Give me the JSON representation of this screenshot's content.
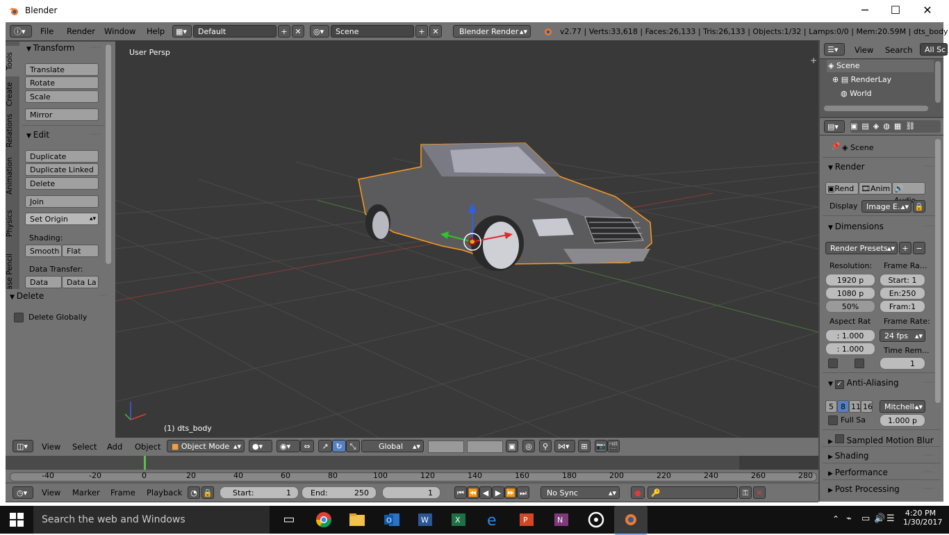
{
  "window": {
    "title": "Blender"
  },
  "info_header": {
    "menus": [
      "File",
      "Render",
      "Window",
      "Help"
    ],
    "layout": "Default",
    "scene": "Scene",
    "engine": "Blender Render",
    "stats": "v2.77 | Verts:33,618 | Faces:26,133 | Tris:26,133 | Objects:1/32 | Lamps:0/0 | Mem:20.59M | dts_body"
  },
  "tool_tabs": [
    "Tools",
    "Create",
    "Relations",
    "Animation",
    "Physics",
    "Grease Pencil"
  ],
  "toolshelf": {
    "transform_title": "Transform",
    "translate": "Translate",
    "rotate": "Rotate",
    "scale": "Scale",
    "mirror": "Mirror",
    "edit_title": "Edit",
    "duplicate": "Duplicate",
    "duplicate_linked": "Duplicate Linked",
    "delete": "Delete",
    "join": "Join",
    "set_origin": "Set Origin",
    "shading_label": "Shading:",
    "smooth": "Smooth",
    "flat": "Flat",
    "data_transfer_label": "Data Transfer:",
    "data": "Data",
    "data_layout": "Data La"
  },
  "operator_panel": {
    "title": "Delete",
    "delete_globally": "Delete Globally"
  },
  "viewport": {
    "view_name": "User Persp",
    "object_name": "(1) dts_body"
  },
  "viewport_header": {
    "menus": [
      "View",
      "Select",
      "Add",
      "Object"
    ],
    "mode": "Object Mode",
    "orientation": "Global"
  },
  "timeline": {
    "ticks": [
      "-40",
      "-20",
      "0",
      "20",
      "40",
      "60",
      "80",
      "100",
      "120",
      "140",
      "160",
      "180",
      "200",
      "220",
      "240",
      "260",
      "280"
    ],
    "current_frame_marker": 0,
    "menus": [
      "View",
      "Marker",
      "Frame",
      "Playback"
    ],
    "start_label": "Start:",
    "start": "1",
    "end_label": "End:",
    "end": "250",
    "current": "1",
    "sync": "No Sync"
  },
  "outliner": {
    "menus": [
      "View",
      "Search"
    ],
    "filter": "All Sc",
    "items": [
      "Scene",
      "RenderLay",
      "World"
    ]
  },
  "properties": {
    "context": "Scene",
    "render_title": "Render",
    "render_btn": "Rend",
    "anim_btn": "Anim",
    "audio_btn": "Audio",
    "display_label": "Display",
    "display_value": "Image E...",
    "dimensions_title": "Dimensions",
    "render_presets": "Render Presets",
    "resolution_label": "Resolution:",
    "res_x": "1920 p",
    "res_y": "1080 p",
    "res_pct": "50%",
    "frame_range_label": "Frame Ra...",
    "frame_start": "Start: 1",
    "frame_end": "En:250",
    "frame_step": "Fram:1",
    "aspect_label": "Aspect Rat",
    "aspect_x": ": 1.000",
    "aspect_y": ": 1.000",
    "frame_rate_label": "Frame Rate:",
    "frame_rate": "24 fps",
    "time_remap_label": "Time Rem...",
    "time_remap": "1",
    "aa_title": "Anti-Aliasing",
    "aa_samples": [
      "5",
      "8",
      "11",
      "16"
    ],
    "aa_filter": "Mitchell-",
    "full_sample": "Full Sa",
    "filter_size": "1.000 p",
    "collapsed_panels": [
      "Sampled Motion Blur",
      "Shading",
      "Performance",
      "Post Processing"
    ]
  },
  "taskbar": {
    "search_placeholder": "Search the web and Windows",
    "time": "4:20 PM",
    "date": "1/30/2017"
  },
  "colors": {
    "selection_outline": "#ff9a1c",
    "timeline_cursor": "#5ac24a",
    "accent_blue": "#5680c2"
  }
}
